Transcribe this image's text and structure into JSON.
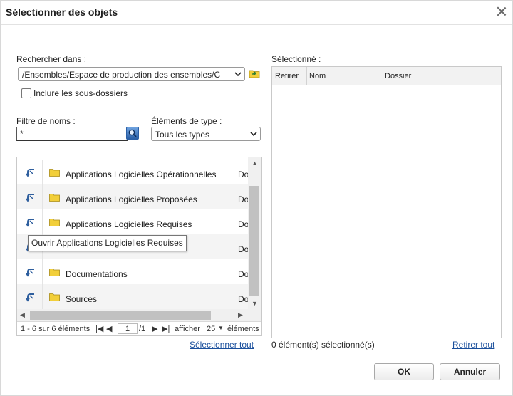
{
  "dialog": {
    "title": "Sélectionner des objets"
  },
  "search": {
    "label": "Rechercher dans :",
    "path": "/Ensembles/Espace de production des ensembles/C",
    "include_subfolders": "Inclure les sous-dossiers",
    "include_subfolders_checked": false
  },
  "filter": {
    "label": "Filtre de noms :",
    "value": "*"
  },
  "type": {
    "label": "Éléments de type :",
    "value": "Tous les types"
  },
  "browse": {
    "items": [
      {
        "name": "Applications Logicielles Opérationnelles",
        "type": "Do"
      },
      {
        "name": "Applications Logicielles Proposées",
        "type": "Do"
      },
      {
        "name": "Applications Logicielles Requises",
        "type": "Do"
      },
      {
        "name": "",
        "type": "Do"
      },
      {
        "name": "Documentations",
        "type": "Do"
      },
      {
        "name": "Sources",
        "type": "Do"
      }
    ],
    "tooltip": "Ouvrir Applications Logicielles Requises",
    "pager": {
      "range": "1 - 6 sur 6 éléments",
      "page": "1",
      "total_pages": "/1",
      "show_label": "afficher",
      "page_size": "25",
      "items_label": "éléments"
    },
    "select_all": "Sélectionner tout"
  },
  "selected": {
    "label": "Sélectionné :",
    "columns": [
      "Retirer",
      "Nom",
      "Dossier"
    ],
    "count_text": "0 élément(s) sélectionné(s)",
    "remove_all": "Retirer tout"
  },
  "buttons": {
    "ok": "OK",
    "cancel": "Annuler"
  },
  "colors": {
    "link": "#1a4f9c",
    "folder": "#f2cf3a",
    "open_arrow": "#2f5f9e"
  }
}
